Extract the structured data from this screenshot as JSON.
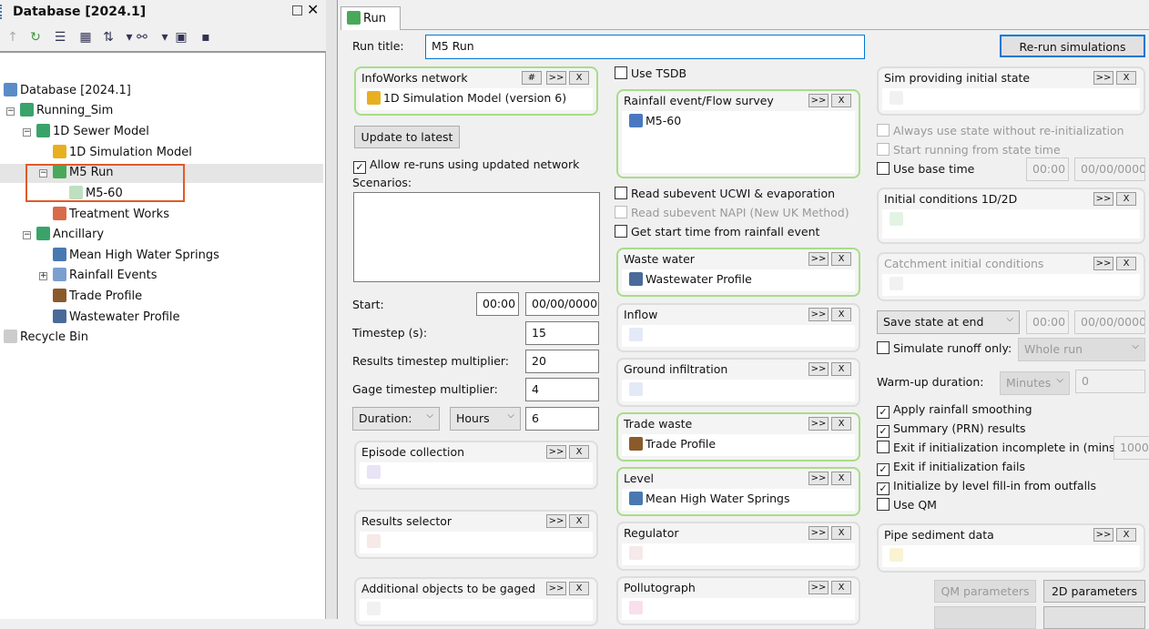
{
  "left_panel": {
    "title": "Database [2024.1]",
    "toolbar": [
      "up-arrow-icon",
      "refresh-icon",
      "list-icon",
      "properties-icon",
      "sort-icon",
      "dropdown-icon",
      "binoculars-icon",
      "dropdown-icon",
      "find-window-icon",
      "tree-icon"
    ],
    "tree": [
      {
        "label": "Database [2024.1]",
        "icon": "database-icon",
        "color": "#5b8cc7"
      },
      {
        "label": "Running_Sim",
        "icon": "model-group-icon",
        "color": "#3aa36a"
      },
      {
        "label": "1D Sewer Model",
        "icon": "model-group-icon",
        "color": "#3aa36a"
      },
      {
        "label": "1D Simulation Model",
        "icon": "network-icon",
        "color": "#e8b020"
      },
      {
        "label": "M5 Run",
        "icon": "run-icon",
        "color": "#4aa85a",
        "selected": true
      },
      {
        "label": "M5-60",
        "icon": "sim-icon",
        "color": "#bfe0c0"
      },
      {
        "label": "Treatment Works",
        "icon": "treatment-icon",
        "color": "#d96a4a"
      },
      {
        "label": "Ancillary",
        "icon": "model-group-icon",
        "color": "#3aa36a"
      },
      {
        "label": "Mean High Water Springs",
        "icon": "level-icon",
        "color": "#4a78b0"
      },
      {
        "label": "Rainfall Events",
        "icon": "rainfall-icon",
        "color": "#7aa0d0"
      },
      {
        "label": "Trade Profile",
        "icon": "trade-icon",
        "color": "#8b5a2b"
      },
      {
        "label": "Wastewater Profile",
        "icon": "wastewater-icon",
        "color": "#4a6a9a"
      },
      {
        "label": "Recycle Bin",
        "icon": "recycle-bin-icon",
        "color": "#ccc"
      }
    ],
    "highlight_color": "#e05a2a"
  },
  "tab": {
    "label": "Run"
  },
  "form": {
    "run_title_label": "Run title:",
    "run_title_value": "M5 Run",
    "rerun_button": "Re-run simulations",
    "update_button": "Update to latest",
    "allow_reruns": {
      "label": "Allow re-runs using updated network",
      "checked": true
    },
    "scenarios_label": "Scenarios:",
    "start_label": "Start:",
    "start_time": "00:00",
    "start_date": "00/00/0000",
    "timestep_label": "Timestep (s):",
    "timestep": "15",
    "results_mult_label": "Results timestep multiplier:",
    "results_mult": "20",
    "gage_mult_label": "Gage timestep multiplier:",
    "gage_mult": "4",
    "duration_select": "Duration:",
    "duration_unit": "Hours",
    "duration": "6",
    "slots": [
      {
        "title": "InfoWorks network",
        "value": "1D Simulation Model (version 6)",
        "active": true,
        "hash": "#"
      },
      {
        "title": "Episode collection",
        "value": ""
      },
      {
        "title": "Results selector",
        "value": ""
      },
      {
        "title": "Additional objects to be gaged",
        "value": ""
      },
      {
        "title": "Rainfall event/Flow survey",
        "value": "M5-60",
        "active": true
      },
      {
        "title": "Waste water",
        "value": "Wastewater Profile",
        "active": true
      },
      {
        "title": "Inflow",
        "value": ""
      },
      {
        "title": "Ground infiltration",
        "value": ""
      },
      {
        "title": "Trade waste",
        "value": "Trade Profile",
        "active": true
      },
      {
        "title": "Level",
        "value": "Mean High Water Springs",
        "active": true
      },
      {
        "title": "Regulator",
        "value": ""
      },
      {
        "title": "Pollutograph",
        "value": ""
      },
      {
        "title": "Sim providing initial state",
        "value": ""
      },
      {
        "title": "Initial conditions 1D/2D",
        "value": ""
      },
      {
        "title": "Catchment initial conditions",
        "value": "",
        "disabled": true
      },
      {
        "title": "Pipe sediment data",
        "value": ""
      }
    ],
    "slot_buttons": {
      "browse": ">>",
      "clear": "X"
    },
    "checks": [
      {
        "label": "Use TSDB",
        "checked": false
      },
      {
        "label": "Read subevent UCWI & evaporation",
        "checked": false
      },
      {
        "label": "Read subevent NAPI (New UK Method)",
        "checked": false,
        "disabled": true
      },
      {
        "label": "Get start time from rainfall event",
        "checked": false
      },
      {
        "label": "Always use state without re-initialization",
        "checked": false,
        "disabled": true
      },
      {
        "label": "Start running from state time",
        "checked": false,
        "disabled": true
      },
      {
        "label": "Use base time",
        "checked": false
      },
      {
        "label": "Simulate runoff only:",
        "checked": false
      },
      {
        "label": "Apply rainfall smoothing",
        "checked": true
      },
      {
        "label": "Summary (PRN) results",
        "checked": true
      },
      {
        "label": "Exit if initialization incomplete in (mins):",
        "checked": false
      },
      {
        "label": "Exit if initialization fails",
        "checked": true
      },
      {
        "label": "Initialize by level fill-in from outfalls",
        "checked": true
      },
      {
        "label": "Use QM",
        "checked": false
      }
    ],
    "base_time": "00:00",
    "base_date": "00/00/0000",
    "save_state_select": "Save state at end",
    "save_time": "00:00",
    "save_date": "00/00/0000",
    "runoff_select": "Whole run",
    "warmup_label": "Warm-up duration:",
    "warmup_unit": "Minutes",
    "warmup": "0",
    "init_incomplete_mins": "1000",
    "qm_button": "QM parameters",
    "twod_button": "2D parameters"
  }
}
